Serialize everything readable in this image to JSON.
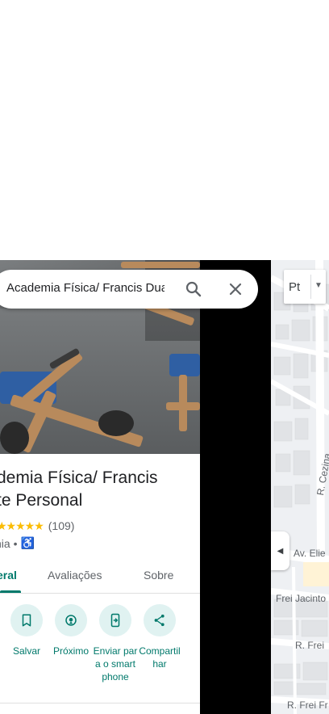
{
  "search": {
    "value": "Academia Física/ Francis Duarte Personal"
  },
  "place": {
    "title_line1": "demia Física/ Francis",
    "title_line2": "te Personal",
    "stars": "★★★★★",
    "review_count": "(109)",
    "category": "nia •",
    "accessibility_icon": "wheelchair-icon"
  },
  "tabs": [
    {
      "label": "eral",
      "active": true
    },
    {
      "label": "Avaliações",
      "active": false
    },
    {
      "label": "Sobre",
      "active": false
    }
  ],
  "actions": [
    {
      "label": "Salvar",
      "icon": "bookmark-icon"
    },
    {
      "label": "Próximo",
      "icon": "nearby-icon"
    },
    {
      "label": "Enviar para o smartphone",
      "icon": "send-to-phone-icon"
    },
    {
      "label": "Compartilhar",
      "icon": "share-icon"
    }
  ],
  "map": {
    "language_button": "Pt",
    "streets": {
      "s1": "R. Cezina",
      "s2": "Av. Elie",
      "s3": "Frei Jacinto",
      "s4": "R. Frei",
      "s5": "R. Frei Fr"
    }
  },
  "colors": {
    "accent": "#00796b",
    "action_bg": "#e0f2f1",
    "star": "#fbbc04",
    "map_bg": "#eef0f3"
  }
}
